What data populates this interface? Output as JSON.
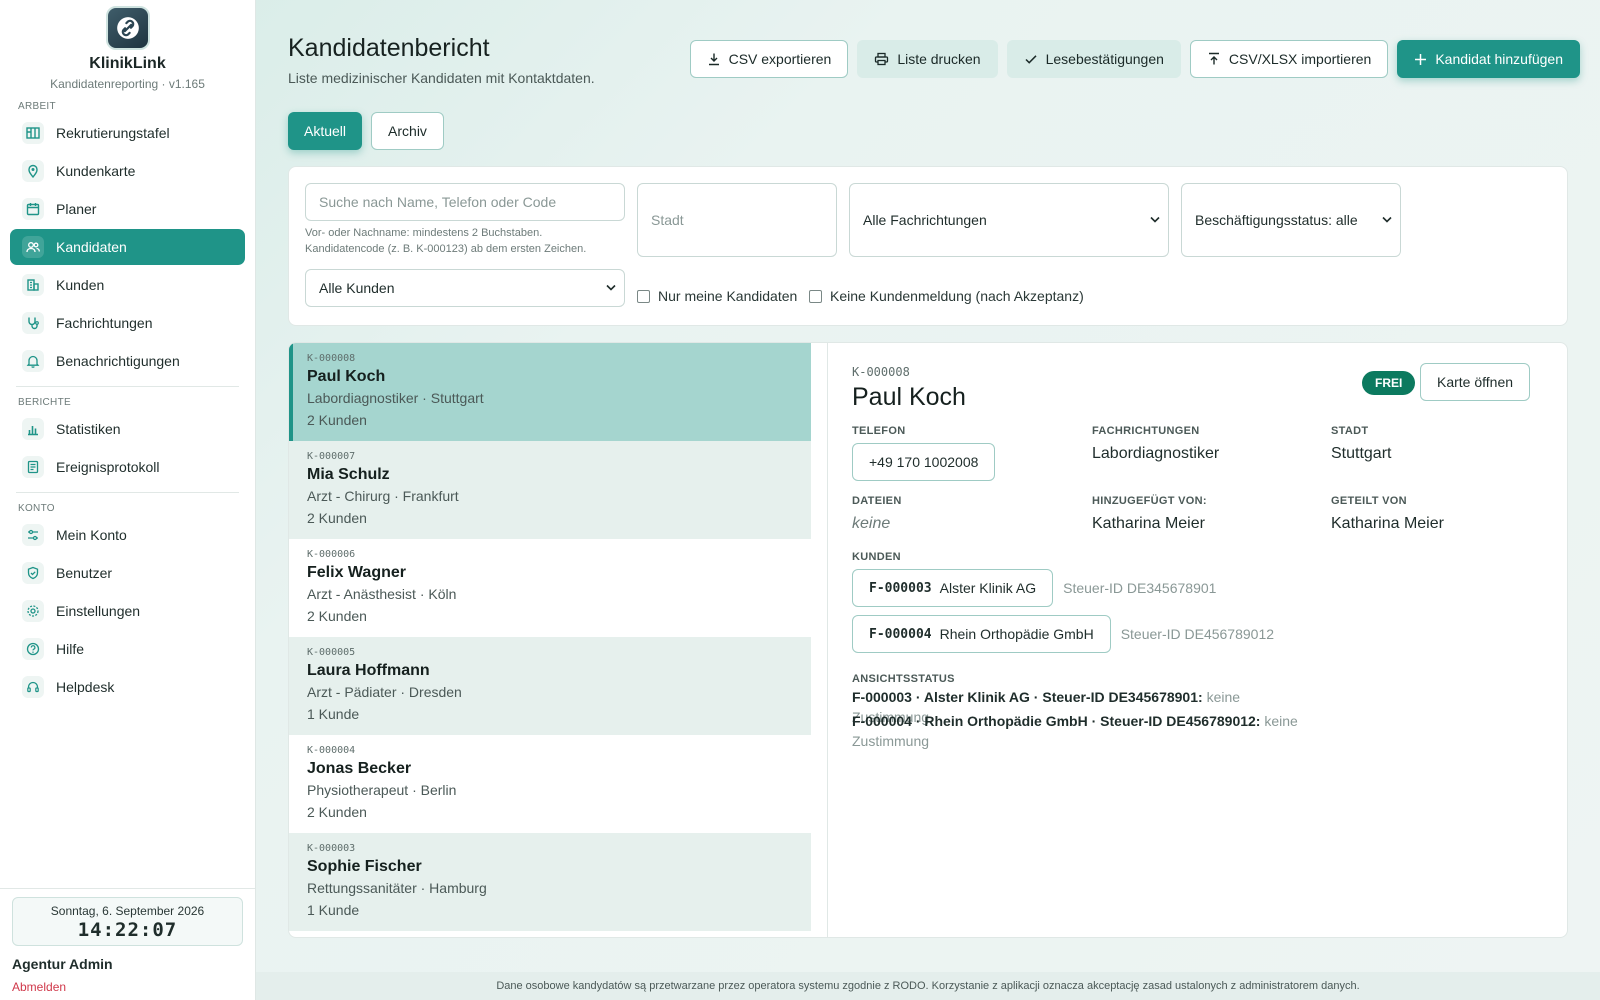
{
  "app": {
    "name": "KlinikLink",
    "subtitle": "Kandidatenreporting · v1.165"
  },
  "sidebar": {
    "sections": [
      {
        "title": "ARBEIT",
        "items": [
          {
            "label": "Rekrutierungstafel",
            "icon": "board-icon"
          },
          {
            "label": "Kundenkarte",
            "icon": "map-pin-icon"
          },
          {
            "label": "Planer",
            "icon": "calendar-icon"
          },
          {
            "label": "Kandidaten",
            "icon": "users-icon",
            "active": true
          },
          {
            "label": "Kunden",
            "icon": "building-icon"
          },
          {
            "label": "Fachrichtungen",
            "icon": "stethoscope-icon"
          },
          {
            "label": "Benachrichtigungen",
            "icon": "bell-icon"
          }
        ]
      },
      {
        "title": "BERICHTE",
        "items": [
          {
            "label": "Statistiken",
            "icon": "bar-chart-icon"
          },
          {
            "label": "Ereignisprotokoll",
            "icon": "log-icon"
          }
        ]
      },
      {
        "title": "KONTO",
        "items": [
          {
            "label": "Mein Konto",
            "icon": "sliders-icon"
          },
          {
            "label": "Benutzer",
            "icon": "shield-icon"
          },
          {
            "label": "Einstellungen",
            "icon": "gear-icon"
          },
          {
            "label": "Hilfe",
            "icon": "help-icon"
          },
          {
            "label": "Helpdesk",
            "icon": "headset-icon"
          }
        ]
      }
    ],
    "footer": {
      "date": "Sonntag, 6. September 2026",
      "time": "14:22:07",
      "user": "Agentur Admin",
      "logout": "Abmelden"
    }
  },
  "header": {
    "title": "Kandidatenbericht",
    "subtitle": "Liste medizinischer Kandidaten mit Kontaktdaten.",
    "buttons": {
      "export_csv": "CSV exportieren",
      "print": "Liste drucken",
      "read_receipts": "Lesebestätigungen",
      "import": "CSV/XLSX importieren",
      "add": "Kandidat hinzufügen"
    }
  },
  "tabs": {
    "current": "Aktuell",
    "archive": "Archiv"
  },
  "filters": {
    "search_placeholder": "Suche nach Name, Telefon oder Code",
    "search_hint_1": "Vor- oder Nachname: mindestens 2 Buchstaben.",
    "search_hint_2": "Kandidatencode (z. B. K-000123) ab dem ersten Zeichen.",
    "city_placeholder": "Stadt",
    "specialty": "Alle Fachrichtungen",
    "employment": "Beschäftigungsstatus: alle",
    "clients": "Alle Kunden",
    "only_mine": "Nur meine Kandidaten",
    "no_report": "Keine Kundenmeldung (nach Akzeptanz)"
  },
  "candidates": [
    {
      "code": "K-000008",
      "name": "Paul Koch",
      "meta": "Labordiagnostiker · Stuttgart",
      "count": "2 Kunden"
    },
    {
      "code": "K-000007",
      "name": "Mia Schulz",
      "meta": "Arzt - Chirurg · Frankfurt",
      "count": "2 Kunden"
    },
    {
      "code": "K-000006",
      "name": "Felix Wagner",
      "meta": "Arzt - Anästhesist · Köln",
      "count": "2 Kunden"
    },
    {
      "code": "K-000005",
      "name": "Laura Hoffmann",
      "meta": "Arzt - Pädiater · Dresden",
      "count": "1 Kunde"
    },
    {
      "code": "K-000004",
      "name": "Jonas Becker",
      "meta": "Physiotherapeut · Berlin",
      "count": "2 Kunden"
    },
    {
      "code": "K-000003",
      "name": "Sophie Fischer",
      "meta": "Rettungssanitäter · Hamburg",
      "count": "1 Kunde"
    }
  ],
  "detail": {
    "code": "K-000008",
    "name": "Paul Koch",
    "badge": "FREI",
    "open_card": "Karte öffnen",
    "labels": {
      "phone": "TELEFON",
      "specialties": "FACHRICHTUNGEN",
      "city": "STADT",
      "files": "DATEIEN",
      "added_by": "HINZUGEFÜGT VON:",
      "shared_by": "GETEILT VON",
      "clients": "KUNDEN",
      "view_status": "ANSICHTSSTATUS"
    },
    "phone": "+49 170 1002008",
    "specialty": "Labordiagnostiker",
    "city": "Stuttgart",
    "files": "keine",
    "added_by": "Katharina Meier",
    "shared_by": "Katharina Meier",
    "clients": [
      {
        "code": "F-000003",
        "name": "Alster Klinik AG",
        "tax": "Steuer-ID DE345678901"
      },
      {
        "code": "F-000004",
        "name": "Rhein Orthopädie GmbH",
        "tax": "Steuer-ID DE456789012"
      }
    ],
    "consent": [
      {
        "label": "F-000003 · Alster Klinik AG · Steuer-ID DE345678901:",
        "status": "keine Zustimmung"
      },
      {
        "label": "F-000004 · Rhein Orthopädie GmbH · Steuer-ID DE456789012:",
        "status": "keine Zustimmung"
      }
    ]
  },
  "footer_note": "Dane osobowe kandydatów są przetwarzane przez operatora systemu zgodnie z RODO. Korzystanie z aplikacji oznacza akceptację zasad ustalonych z administratorem danych."
}
